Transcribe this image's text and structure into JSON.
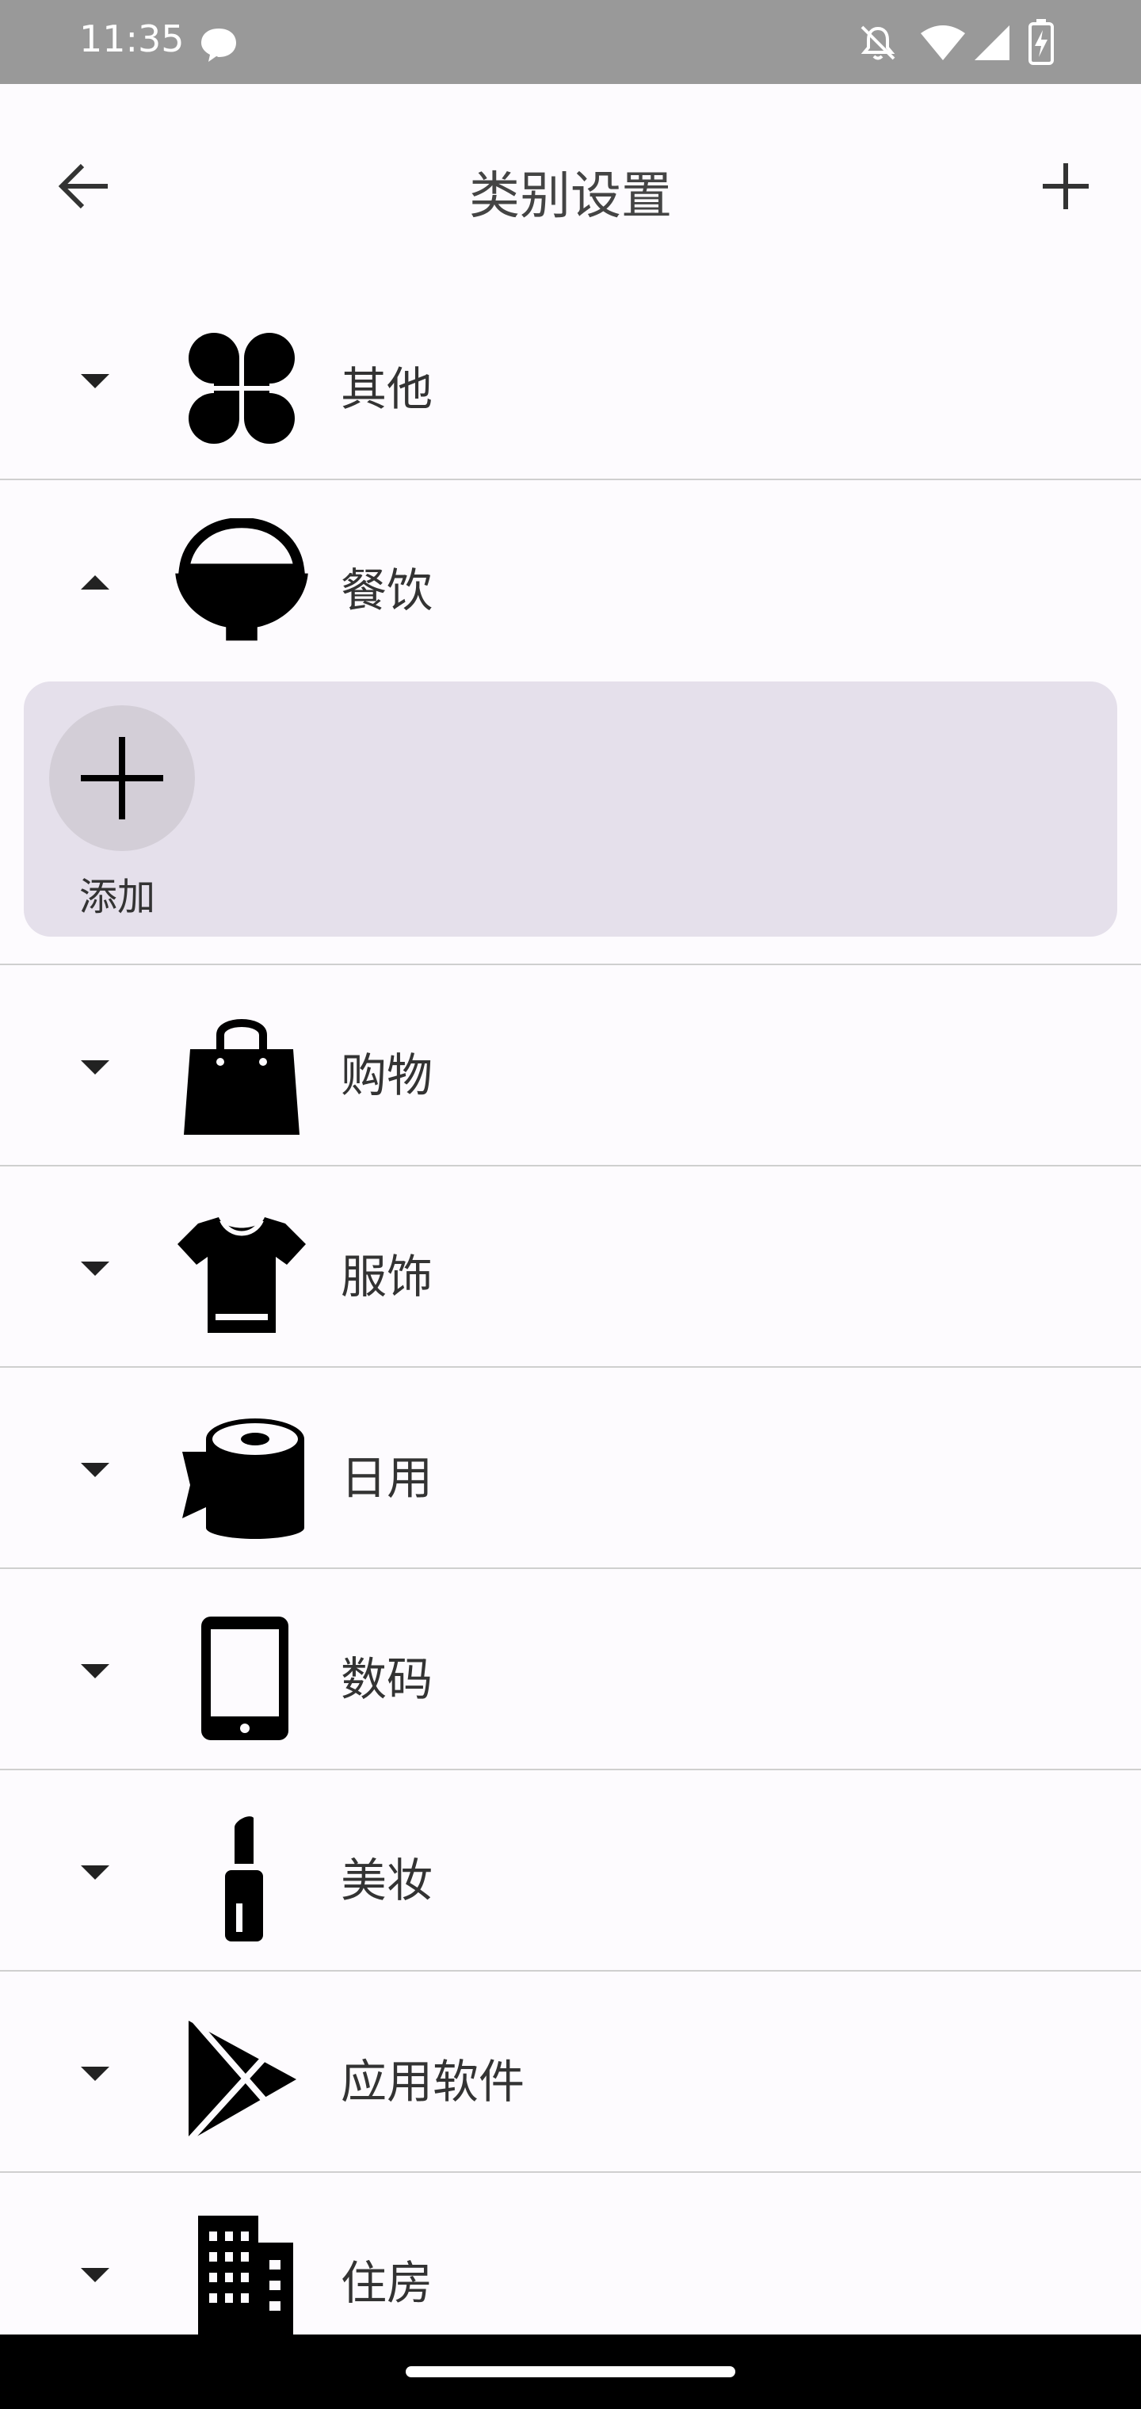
{
  "status_bar": {
    "time": "11:35",
    "icons": [
      "chat-bubble-icon",
      "bell-off-icon",
      "wifi-icon",
      "signal-icon",
      "battery-charging-icon"
    ]
  },
  "app_bar": {
    "title": "类别设置",
    "back_icon": "arrow-left-icon",
    "add_icon": "plus-icon"
  },
  "categories": [
    {
      "label": "其他",
      "icon": "clover-icon",
      "expanded": false
    },
    {
      "label": "餐饮",
      "icon": "rice-bowl-icon",
      "expanded": true,
      "children_panel": {
        "add_label": "添加",
        "add_icon": "plus-icon"
      }
    },
    {
      "label": "购物",
      "icon": "shopping-bag-icon",
      "expanded": false
    },
    {
      "label": "服饰",
      "icon": "tshirt-icon",
      "expanded": false
    },
    {
      "label": "日用",
      "icon": "paper-roll-icon",
      "expanded": false
    },
    {
      "label": "数码",
      "icon": "smartphone-icon",
      "expanded": false
    },
    {
      "label": "美妆",
      "icon": "lipstick-icon",
      "expanded": false
    },
    {
      "label": "应用软件",
      "icon": "play-store-icon",
      "expanded": false
    },
    {
      "label": "住房",
      "icon": "building-icon",
      "expanded": false
    }
  ],
  "colors": {
    "background": "#fdfbfe",
    "status_bar": "#999999",
    "expanded_panel": "#e5e0eb",
    "add_circle": "#d3ced7",
    "divider": "#cfcfcf"
  }
}
